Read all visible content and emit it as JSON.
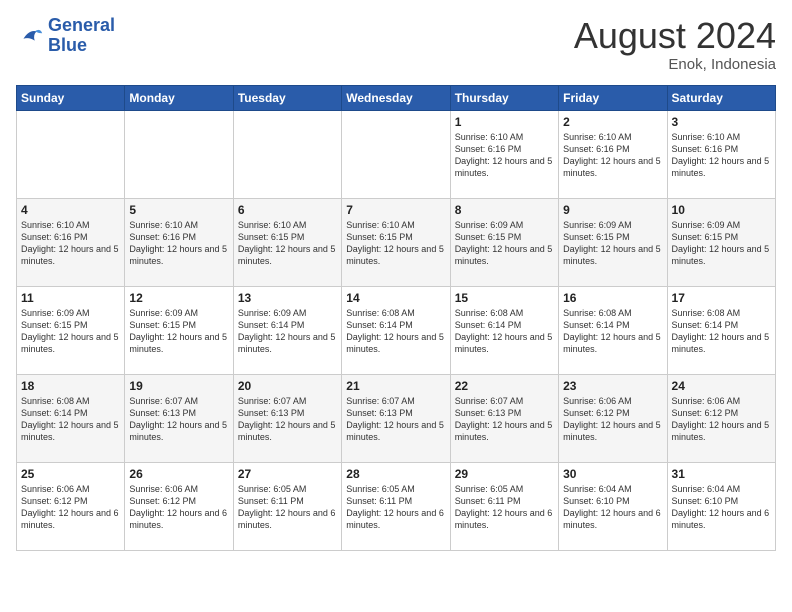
{
  "header": {
    "logo_line1": "General",
    "logo_line2": "Blue",
    "month_title": "August 2024",
    "location": "Enok, Indonesia"
  },
  "days_of_week": [
    "Sunday",
    "Monday",
    "Tuesday",
    "Wednesday",
    "Thursday",
    "Friday",
    "Saturday"
  ],
  "weeks": [
    [
      {
        "day": "",
        "info": ""
      },
      {
        "day": "",
        "info": ""
      },
      {
        "day": "",
        "info": ""
      },
      {
        "day": "",
        "info": ""
      },
      {
        "day": "1",
        "info": "Sunrise: 6:10 AM\nSunset: 6:16 PM\nDaylight: 12 hours and 5 minutes."
      },
      {
        "day": "2",
        "info": "Sunrise: 6:10 AM\nSunset: 6:16 PM\nDaylight: 12 hours and 5 minutes."
      },
      {
        "day": "3",
        "info": "Sunrise: 6:10 AM\nSunset: 6:16 PM\nDaylight: 12 hours and 5 minutes."
      }
    ],
    [
      {
        "day": "4",
        "info": "Sunrise: 6:10 AM\nSunset: 6:16 PM\nDaylight: 12 hours and 5 minutes."
      },
      {
        "day": "5",
        "info": "Sunrise: 6:10 AM\nSunset: 6:16 PM\nDaylight: 12 hours and 5 minutes."
      },
      {
        "day": "6",
        "info": "Sunrise: 6:10 AM\nSunset: 6:15 PM\nDaylight: 12 hours and 5 minutes."
      },
      {
        "day": "7",
        "info": "Sunrise: 6:10 AM\nSunset: 6:15 PM\nDaylight: 12 hours and 5 minutes."
      },
      {
        "day": "8",
        "info": "Sunrise: 6:09 AM\nSunset: 6:15 PM\nDaylight: 12 hours and 5 minutes."
      },
      {
        "day": "9",
        "info": "Sunrise: 6:09 AM\nSunset: 6:15 PM\nDaylight: 12 hours and 5 minutes."
      },
      {
        "day": "10",
        "info": "Sunrise: 6:09 AM\nSunset: 6:15 PM\nDaylight: 12 hours and 5 minutes."
      }
    ],
    [
      {
        "day": "11",
        "info": "Sunrise: 6:09 AM\nSunset: 6:15 PM\nDaylight: 12 hours and 5 minutes."
      },
      {
        "day": "12",
        "info": "Sunrise: 6:09 AM\nSunset: 6:15 PM\nDaylight: 12 hours and 5 minutes."
      },
      {
        "day": "13",
        "info": "Sunrise: 6:09 AM\nSunset: 6:14 PM\nDaylight: 12 hours and 5 minutes."
      },
      {
        "day": "14",
        "info": "Sunrise: 6:08 AM\nSunset: 6:14 PM\nDaylight: 12 hours and 5 minutes."
      },
      {
        "day": "15",
        "info": "Sunrise: 6:08 AM\nSunset: 6:14 PM\nDaylight: 12 hours and 5 minutes."
      },
      {
        "day": "16",
        "info": "Sunrise: 6:08 AM\nSunset: 6:14 PM\nDaylight: 12 hours and 5 minutes."
      },
      {
        "day": "17",
        "info": "Sunrise: 6:08 AM\nSunset: 6:14 PM\nDaylight: 12 hours and 5 minutes."
      }
    ],
    [
      {
        "day": "18",
        "info": "Sunrise: 6:08 AM\nSunset: 6:14 PM\nDaylight: 12 hours and 5 minutes."
      },
      {
        "day": "19",
        "info": "Sunrise: 6:07 AM\nSunset: 6:13 PM\nDaylight: 12 hours and 5 minutes."
      },
      {
        "day": "20",
        "info": "Sunrise: 6:07 AM\nSunset: 6:13 PM\nDaylight: 12 hours and 5 minutes."
      },
      {
        "day": "21",
        "info": "Sunrise: 6:07 AM\nSunset: 6:13 PM\nDaylight: 12 hours and 5 minutes."
      },
      {
        "day": "22",
        "info": "Sunrise: 6:07 AM\nSunset: 6:13 PM\nDaylight: 12 hours and 5 minutes."
      },
      {
        "day": "23",
        "info": "Sunrise: 6:06 AM\nSunset: 6:12 PM\nDaylight: 12 hours and 5 minutes."
      },
      {
        "day": "24",
        "info": "Sunrise: 6:06 AM\nSunset: 6:12 PM\nDaylight: 12 hours and 5 minutes."
      }
    ],
    [
      {
        "day": "25",
        "info": "Sunrise: 6:06 AM\nSunset: 6:12 PM\nDaylight: 12 hours and 6 minutes."
      },
      {
        "day": "26",
        "info": "Sunrise: 6:06 AM\nSunset: 6:12 PM\nDaylight: 12 hours and 6 minutes."
      },
      {
        "day": "27",
        "info": "Sunrise: 6:05 AM\nSunset: 6:11 PM\nDaylight: 12 hours and 6 minutes."
      },
      {
        "day": "28",
        "info": "Sunrise: 6:05 AM\nSunset: 6:11 PM\nDaylight: 12 hours and 6 minutes."
      },
      {
        "day": "29",
        "info": "Sunrise: 6:05 AM\nSunset: 6:11 PM\nDaylight: 12 hours and 6 minutes."
      },
      {
        "day": "30",
        "info": "Sunrise: 6:04 AM\nSunset: 6:10 PM\nDaylight: 12 hours and 6 minutes."
      },
      {
        "day": "31",
        "info": "Sunrise: 6:04 AM\nSunset: 6:10 PM\nDaylight: 12 hours and 6 minutes."
      }
    ]
  ]
}
